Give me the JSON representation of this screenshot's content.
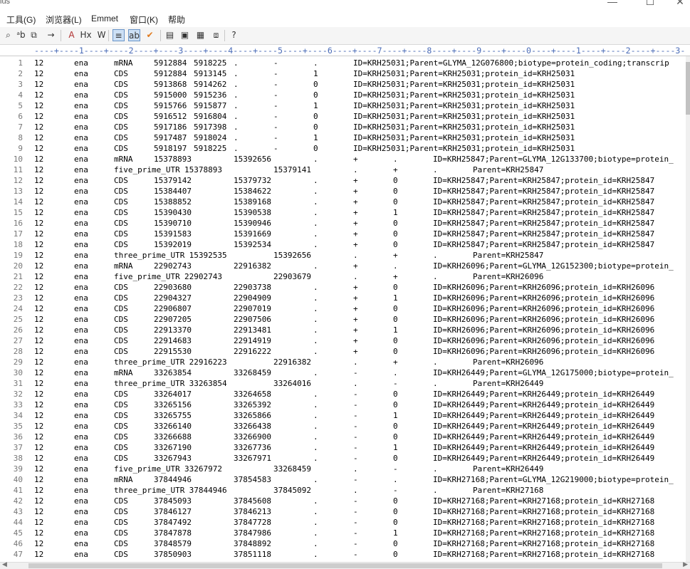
{
  "window": {
    "title": "ius",
    "minimize_glyph": "—",
    "maximize_glyph": "☐",
    "close_glyph": "✕"
  },
  "menu": [
    {
      "label": "工具(G)"
    },
    {
      "label": "浏览器(L)"
    },
    {
      "label": "Emmet"
    },
    {
      "label": "窗口(K)"
    },
    {
      "label": "帮助"
    }
  ],
  "toolbar": [
    {
      "icon": "search-icon",
      "glyph": "⌕"
    },
    {
      "icon": "replace-icon",
      "glyph": "ᵃb"
    },
    {
      "icon": "find-in-files-icon",
      "glyph": "⧉"
    },
    {
      "icon": "goto-line-icon",
      "glyph": "→"
    },
    {
      "icon": "font-icon",
      "glyph": "A"
    },
    {
      "icon": "hex-icon",
      "glyph": "Hx"
    },
    {
      "icon": "word-wrap-icon",
      "glyph": "W"
    },
    {
      "icon": "line-numbers-icon",
      "glyph": "≡",
      "selected": true
    },
    {
      "icon": "ruler-icon",
      "glyph": "ab",
      "selected": true
    },
    {
      "icon": "spell-check-icon",
      "glyph": "✔"
    },
    {
      "icon": "list-icon",
      "glyph": "▤"
    },
    {
      "icon": "clipboard-icon",
      "glyph": "▣"
    },
    {
      "icon": "tags-icon",
      "glyph": "▦"
    },
    {
      "icon": "output-icon",
      "glyph": "⧈"
    },
    {
      "icon": "help-icon",
      "glyph": "?"
    }
  ],
  "ruler": "----+----1----+----2----+----3----+----4----+----5----+----6----+----7----+----8----+----9----+----0----+----1----+----2----+----3-",
  "lines": [
    {
      "n": "1",
      "seq": "12",
      "src": "ena",
      "type": "mRNA",
      "start": "5912884",
      "end": "5918225",
      "score": ".",
      "strand": "-",
      "phase": ".",
      "attr": "ID=KRH25031;Parent=GLYMA_12G076800;biotype=protein_coding;transcrip"
    },
    {
      "n": "2",
      "seq": "12",
      "src": "ena",
      "type": "CDS",
      "start": "5912884",
      "end": "5913145",
      "score": ".",
      "strand": "-",
      "phase": "1",
      "attr": "ID=KRH25031;Parent=KRH25031;protein_id=KRH25031"
    },
    {
      "n": "3",
      "seq": "12",
      "src": "ena",
      "type": "CDS",
      "start": "5913868",
      "end": "5914262",
      "score": ".",
      "strand": "-",
      "phase": "0",
      "attr": "ID=KRH25031;Parent=KRH25031;protein_id=KRH25031"
    },
    {
      "n": "4",
      "seq": "12",
      "src": "ena",
      "type": "CDS",
      "start": "5915000",
      "end": "5915236",
      "score": ".",
      "strand": "-",
      "phase": "0",
      "attr": "ID=KRH25031;Parent=KRH25031;protein_id=KRH25031"
    },
    {
      "n": "5",
      "seq": "12",
      "src": "ena",
      "type": "CDS",
      "start": "5915766",
      "end": "5915877",
      "score": ".",
      "strand": "-",
      "phase": "1",
      "attr": "ID=KRH25031;Parent=KRH25031;protein_id=KRH25031"
    },
    {
      "n": "6",
      "seq": "12",
      "src": "ena",
      "type": "CDS",
      "start": "5916512",
      "end": "5916804",
      "score": ".",
      "strand": "-",
      "phase": "0",
      "attr": "ID=KRH25031;Parent=KRH25031;protein_id=KRH25031"
    },
    {
      "n": "7",
      "seq": "12",
      "src": "ena",
      "type": "CDS",
      "start": "5917186",
      "end": "5917398",
      "score": ".",
      "strand": "-",
      "phase": "0",
      "attr": "ID=KRH25031;Parent=KRH25031;protein_id=KRH25031"
    },
    {
      "n": "8",
      "seq": "12",
      "src": "ena",
      "type": "CDS",
      "start": "5917487",
      "end": "5918024",
      "score": ".",
      "strand": "-",
      "phase": "1",
      "attr": "ID=KRH25031;Parent=KRH25031;protein_id=KRH25031"
    },
    {
      "n": "9",
      "seq": "12",
      "src": "ena",
      "type": "CDS",
      "start": "5918197",
      "end": "5918225",
      "score": ".",
      "strand": "-",
      "phase": "0",
      "attr": "ID=KRH25031;Parent=KRH25031;protein_id=KRH25031"
    },
    {
      "n": "10",
      "seq": "12",
      "src": "ena",
      "type": "mRNA",
      "start": "15378893",
      "end": "15392656",
      "score": ".",
      "strand": "+",
      "phase": ".",
      "attr": "ID=KRH25847;Parent=GLYMA_12G133700;biotype=protein_"
    },
    {
      "n": "11",
      "seq": "12",
      "src": "ena",
      "type": "five_prime_UTR",
      "start": "15378893",
      "end": "15379141",
      "score": ".",
      "strand": "+",
      "phase": ".",
      "attr": "Parent=KRH25847"
    },
    {
      "n": "12",
      "seq": "12",
      "src": "ena",
      "type": "CDS",
      "start": "15379142",
      "end": "15379732",
      "score": ".",
      "strand": "+",
      "phase": "0",
      "attr": "ID=KRH25847;Parent=KRH25847;protein_id=KRH25847"
    },
    {
      "n": "13",
      "seq": "12",
      "src": "ena",
      "type": "CDS",
      "start": "15384407",
      "end": "15384622",
      "score": ".",
      "strand": "+",
      "phase": "0",
      "attr": "ID=KRH25847;Parent=KRH25847;protein_id=KRH25847"
    },
    {
      "n": "14",
      "seq": "12",
      "src": "ena",
      "type": "CDS",
      "start": "15388852",
      "end": "15389168",
      "score": ".",
      "strand": "+",
      "phase": "0",
      "attr": "ID=KRH25847;Parent=KRH25847;protein_id=KRH25847"
    },
    {
      "n": "15",
      "seq": "12",
      "src": "ena",
      "type": "CDS",
      "start": "15390430",
      "end": "15390538",
      "score": ".",
      "strand": "+",
      "phase": "1",
      "attr": "ID=KRH25847;Parent=KRH25847;protein_id=KRH25847"
    },
    {
      "n": "16",
      "seq": "12",
      "src": "ena",
      "type": "CDS",
      "start": "15390710",
      "end": "15390946",
      "score": ".",
      "strand": "+",
      "phase": "0",
      "attr": "ID=KRH25847;Parent=KRH25847;protein_id=KRH25847"
    },
    {
      "n": "17",
      "seq": "12",
      "src": "ena",
      "type": "CDS",
      "start": "15391583",
      "end": "15391669",
      "score": ".",
      "strand": "+",
      "phase": "0",
      "attr": "ID=KRH25847;Parent=KRH25847;protein_id=KRH25847"
    },
    {
      "n": "18",
      "seq": "12",
      "src": "ena",
      "type": "CDS",
      "start": "15392019",
      "end": "15392534",
      "score": ".",
      "strand": "+",
      "phase": "0",
      "attr": "ID=KRH25847;Parent=KRH25847;protein_id=KRH25847"
    },
    {
      "n": "19",
      "seq": "12",
      "src": "ena",
      "type": "three_prime_UTR",
      "start": "15392535",
      "end": "15392656",
      "score": ".",
      "strand": "+",
      "phase": ".",
      "attr": "Parent=KRH25847"
    },
    {
      "n": "20",
      "seq": "12",
      "src": "ena",
      "type": "mRNA",
      "start": "22902743",
      "end": "22916382",
      "score": ".",
      "strand": "+",
      "phase": ".",
      "attr": "ID=KRH26096;Parent=GLYMA_12G152300;biotype=protein_"
    },
    {
      "n": "21",
      "seq": "12",
      "src": "ena",
      "type": "five_prime_UTR",
      "start": "22902743",
      "end": "22903679",
      "score": ".",
      "strand": "+",
      "phase": ".",
      "attr": "Parent=KRH26096"
    },
    {
      "n": "22",
      "seq": "12",
      "src": "ena",
      "type": "CDS",
      "start": "22903680",
      "end": "22903738",
      "score": ".",
      "strand": "+",
      "phase": "0",
      "attr": "ID=KRH26096;Parent=KRH26096;protein_id=KRH26096"
    },
    {
      "n": "23",
      "seq": "12",
      "src": "ena",
      "type": "CDS",
      "start": "22904327",
      "end": "22904909",
      "score": ".",
      "strand": "+",
      "phase": "1",
      "attr": "ID=KRH26096;Parent=KRH26096;protein_id=KRH26096"
    },
    {
      "n": "24",
      "seq": "12",
      "src": "ena",
      "type": "CDS",
      "start": "22906807",
      "end": "22907019",
      "score": ".",
      "strand": "+",
      "phase": "0",
      "attr": "ID=KRH26096;Parent=KRH26096;protein_id=KRH26096"
    },
    {
      "n": "25",
      "seq": "12",
      "src": "ena",
      "type": "CDS",
      "start": "22907205",
      "end": "22907506",
      "score": ".",
      "strand": "+",
      "phase": "0",
      "attr": "ID=KRH26096;Parent=KRH26096;protein_id=KRH26096"
    },
    {
      "n": "26",
      "seq": "12",
      "src": "ena",
      "type": "CDS",
      "start": "22913370",
      "end": "22913481",
      "score": ".",
      "strand": "+",
      "phase": "1",
      "attr": "ID=KRH26096;Parent=KRH26096;protein_id=KRH26096"
    },
    {
      "n": "27",
      "seq": "12",
      "src": "ena",
      "type": "CDS",
      "start": "22914683",
      "end": "22914919",
      "score": ".",
      "strand": "+",
      "phase": "0",
      "attr": "ID=KRH26096;Parent=KRH26096;protein_id=KRH26096"
    },
    {
      "n": "28",
      "seq": "12",
      "src": "ena",
      "type": "CDS",
      "start": "22915530",
      "end": "22916222",
      "score": ".",
      "strand": "+",
      "phase": "0",
      "attr": "ID=KRH26096;Parent=KRH26096;protein_id=KRH26096"
    },
    {
      "n": "29",
      "seq": "12",
      "src": "ena",
      "type": "three_prime_UTR",
      "start": "22916223",
      "end": "22916382",
      "score": ".",
      "strand": "+",
      "phase": ".",
      "attr": "Parent=KRH26096"
    },
    {
      "n": "30",
      "seq": "12",
      "src": "ena",
      "type": "mRNA",
      "start": "33263854",
      "end": "33268459",
      "score": ".",
      "strand": "-",
      "phase": ".",
      "attr": "ID=KRH26449;Parent=GLYMA_12G175000;biotype=protein_"
    },
    {
      "n": "31",
      "seq": "12",
      "src": "ena",
      "type": "three_prime_UTR",
      "start": "33263854",
      "end": "33264016",
      "score": ".",
      "strand": "-",
      "phase": ".",
      "attr": "Parent=KRH26449"
    },
    {
      "n": "32",
      "seq": "12",
      "src": "ena",
      "type": "CDS",
      "start": "33264017",
      "end": "33264658",
      "score": ".",
      "strand": "-",
      "phase": "0",
      "attr": "ID=KRH26449;Parent=KRH26449;protein_id=KRH26449"
    },
    {
      "n": "33",
      "seq": "12",
      "src": "ena",
      "type": "CDS",
      "start": "33265156",
      "end": "33265392",
      "score": ".",
      "strand": "-",
      "phase": "0",
      "attr": "ID=KRH26449;Parent=KRH26449;protein_id=KRH26449"
    },
    {
      "n": "34",
      "seq": "12",
      "src": "ena",
      "type": "CDS",
      "start": "33265755",
      "end": "33265866",
      "score": ".",
      "strand": "-",
      "phase": "1",
      "attr": "ID=KRH26449;Parent=KRH26449;protein_id=KRH26449"
    },
    {
      "n": "35",
      "seq": "12",
      "src": "ena",
      "type": "CDS",
      "start": "33266140",
      "end": "33266438",
      "score": ".",
      "strand": "-",
      "phase": "0",
      "attr": "ID=KRH26449;Parent=KRH26449;protein_id=KRH26449"
    },
    {
      "n": "36",
      "seq": "12",
      "src": "ena",
      "type": "CDS",
      "start": "33266688",
      "end": "33266900",
      "score": ".",
      "strand": "-",
      "phase": "0",
      "attr": "ID=KRH26449;Parent=KRH26449;protein_id=KRH26449"
    },
    {
      "n": "37",
      "seq": "12",
      "src": "ena",
      "type": "CDS",
      "start": "33267190",
      "end": "33267736",
      "score": ".",
      "strand": "-",
      "phase": "1",
      "attr": "ID=KRH26449;Parent=KRH26449;protein_id=KRH26449"
    },
    {
      "n": "38",
      "seq": "12",
      "src": "ena",
      "type": "CDS",
      "start": "33267943",
      "end": "33267971",
      "score": ".",
      "strand": "-",
      "phase": "0",
      "attr": "ID=KRH26449;Parent=KRH26449;protein_id=KRH26449"
    },
    {
      "n": "39",
      "seq": "12",
      "src": "ena",
      "type": "five_prime_UTR",
      "start": "33267972",
      "end": "33268459",
      "score": ".",
      "strand": "-",
      "phase": ".",
      "attr": "Parent=KRH26449"
    },
    {
      "n": "40",
      "seq": "12",
      "src": "ena",
      "type": "mRNA",
      "start": "37844946",
      "end": "37854583",
      "score": ".",
      "strand": "-",
      "phase": ".",
      "attr": "ID=KRH27168;Parent=GLYMA_12G219000;biotype=protein_"
    },
    {
      "n": "41",
      "seq": "12",
      "src": "ena",
      "type": "three_prime_UTR",
      "start": "37844946",
      "end": "37845092",
      "score": ".",
      "strand": "-",
      "phase": ".",
      "attr": "Parent=KRH27168"
    },
    {
      "n": "42",
      "seq": "12",
      "src": "ena",
      "type": "CDS",
      "start": "37845093",
      "end": "37845608",
      "score": ".",
      "strand": "-",
      "phase": "0",
      "attr": "ID=KRH27168;Parent=KRH27168;protein_id=KRH27168"
    },
    {
      "n": "43",
      "seq": "12",
      "src": "ena",
      "type": "CDS",
      "start": "37846127",
      "end": "37846213",
      "score": ".",
      "strand": "-",
      "phase": "0",
      "attr": "ID=KRH27168;Parent=KRH27168;protein_id=KRH27168"
    },
    {
      "n": "44",
      "seq": "12",
      "src": "ena",
      "type": "CDS",
      "start": "37847492",
      "end": "37847728",
      "score": ".",
      "strand": "-",
      "phase": "0",
      "attr": "ID=KRH27168;Parent=KRH27168;protein_id=KRH27168"
    },
    {
      "n": "45",
      "seq": "12",
      "src": "ena",
      "type": "CDS",
      "start": "37847878",
      "end": "37847986",
      "score": ".",
      "strand": "-",
      "phase": "1",
      "attr": "ID=KRH27168;Parent=KRH27168;protein_id=KRH27168"
    },
    {
      "n": "46",
      "seq": "12",
      "src": "ena",
      "type": "CDS",
      "start": "37848579",
      "end": "37848892",
      "score": ".",
      "strand": "-",
      "phase": "0",
      "attr": "ID=KRH27168;Parent=KRH27168;protein_id=KRH27168"
    },
    {
      "n": "47",
      "seq": "12",
      "src": "ena",
      "type": "CDS",
      "start": "37850903",
      "end": "37851118",
      "score": ".",
      "strand": "-",
      "phase": "0",
      "attr": "ID=KRH27168;Parent=KRH27168;protein_id=KRH27168"
    }
  ]
}
